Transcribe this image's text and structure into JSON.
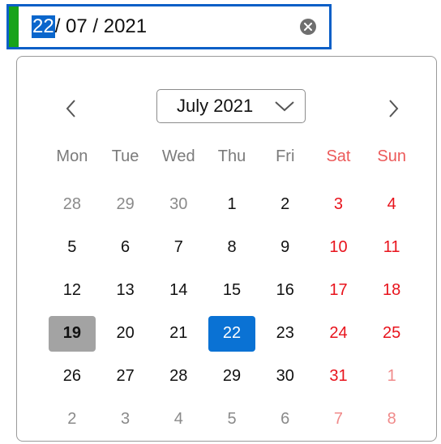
{
  "date_input": {
    "day": "22",
    "rest": "/ 07 / 2021",
    "focus_color": "#17a31a",
    "border_color": "#0b5fc7",
    "clear_icon": "clear-circle-icon"
  },
  "calendar": {
    "month_label": "July 2021",
    "prev_icon": "chevron-left-icon",
    "next_icon": "chevron-right-icon",
    "dropdown_icon": "chevron-down-icon",
    "weekdays": [
      "Mon",
      "Tue",
      "Wed",
      "Thu",
      "Fri",
      "Sat",
      "Sun"
    ],
    "weeks": [
      [
        {
          "d": "28",
          "other": true
        },
        {
          "d": "29",
          "other": true
        },
        {
          "d": "30",
          "other": true
        },
        {
          "d": "1"
        },
        {
          "d": "2"
        },
        {
          "d": "3"
        },
        {
          "d": "4"
        }
      ],
      [
        {
          "d": "5"
        },
        {
          "d": "6"
        },
        {
          "d": "7"
        },
        {
          "d": "8"
        },
        {
          "d": "9"
        },
        {
          "d": "10"
        },
        {
          "d": "11"
        }
      ],
      [
        {
          "d": "12"
        },
        {
          "d": "13"
        },
        {
          "d": "14"
        },
        {
          "d": "15"
        },
        {
          "d": "16"
        },
        {
          "d": "17"
        },
        {
          "d": "18"
        }
      ],
      [
        {
          "d": "19",
          "today": true
        },
        {
          "d": "20"
        },
        {
          "d": "21"
        },
        {
          "d": "22",
          "selected": true
        },
        {
          "d": "23"
        },
        {
          "d": "24"
        },
        {
          "d": "25"
        }
      ],
      [
        {
          "d": "26"
        },
        {
          "d": "27"
        },
        {
          "d": "28"
        },
        {
          "d": "29"
        },
        {
          "d": "30"
        },
        {
          "d": "31"
        },
        {
          "d": "1",
          "other": true
        }
      ],
      [
        {
          "d": "2",
          "other": true
        },
        {
          "d": "3",
          "other": true
        },
        {
          "d": "4",
          "other": true
        },
        {
          "d": "5",
          "other": true
        },
        {
          "d": "6",
          "other": true
        },
        {
          "d": "7",
          "other": true
        },
        {
          "d": "8",
          "other": true
        }
      ]
    ],
    "colors": {
      "weekend": "#e8131c",
      "selected": "#0a72d4",
      "today": "#a3a3a3"
    }
  }
}
